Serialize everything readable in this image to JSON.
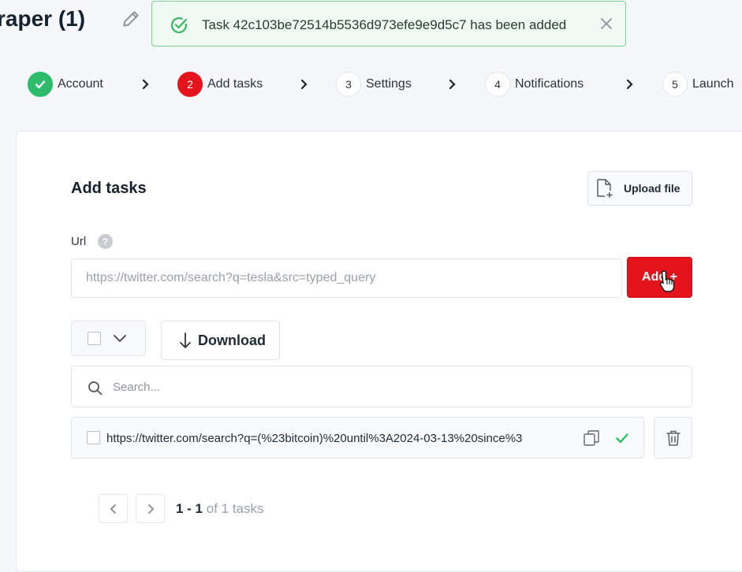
{
  "page": {
    "title": "raper (1)"
  },
  "toast": {
    "message": "Task 42c103be72514b5536d973efe9e9d5c7 has been added"
  },
  "steps": [
    {
      "num": "",
      "label": "Account",
      "state": "done"
    },
    {
      "num": "2",
      "label": "Add tasks",
      "state": "active"
    },
    {
      "num": "3",
      "label": "Settings",
      "state": "pending"
    },
    {
      "num": "4",
      "label": "Notifications",
      "state": "pending"
    },
    {
      "num": "5",
      "label": "Launch",
      "state": "pending"
    }
  ],
  "card": {
    "title": "Add tasks",
    "upload_label": "Upload file",
    "url_label": "Url",
    "help_glyph": "?",
    "url_placeholder": "https://twitter.com/search?q=tesla&src=typed_query",
    "add_label": "Add +",
    "download_label": "Download",
    "search_placeholder": "Search..."
  },
  "tasks": [
    {
      "url": "https://twitter.com/search?q=(%23bitcoin)%20until%3A2024-03-13%20since%3",
      "status": "ok"
    }
  ],
  "pagination": {
    "range": "1 - 1",
    "of_text": "of 1 tasks"
  },
  "colors": {
    "accent": "#e3131b",
    "success": "#2dbd6a",
    "toast_bg": "#effaf2",
    "toast_border": "#7fcf93"
  },
  "icons": [
    "pencil-icon",
    "check-circle-icon",
    "close-icon",
    "chevron-right-icon",
    "file-plus-icon",
    "chevron-down-icon",
    "arrow-down-icon",
    "search-icon",
    "copy-icon",
    "check-icon",
    "trash-icon",
    "chevron-left-icon",
    "hand-cursor-icon"
  ]
}
